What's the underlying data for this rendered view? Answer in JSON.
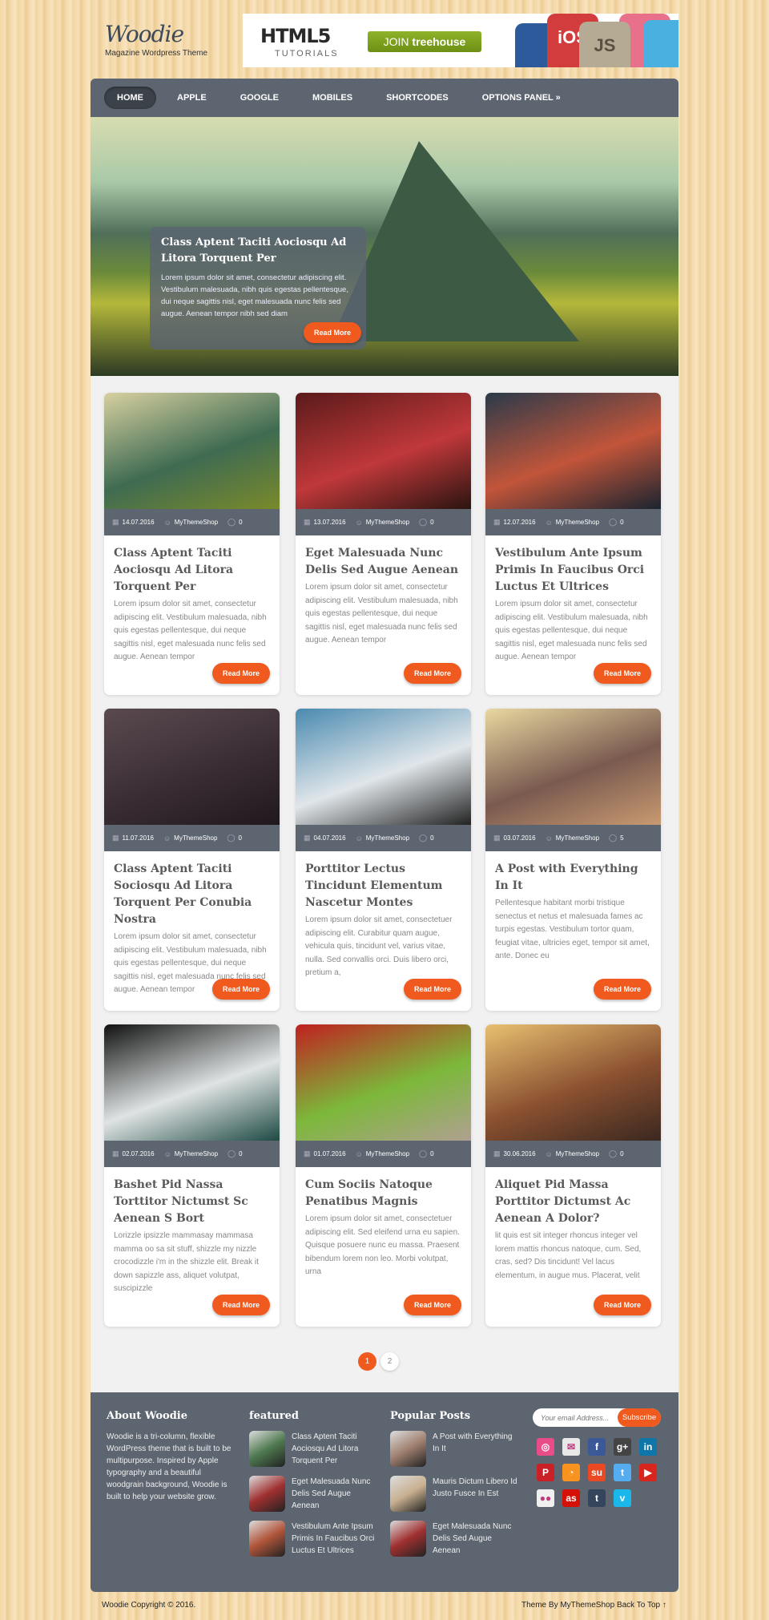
{
  "site": {
    "title": "Woodie",
    "tagline": "Magazine Wordpress Theme"
  },
  "banner": {
    "headline": "HTML5",
    "sub": "TUTORIALS",
    "cta_prefix": "JOIN",
    "cta_brand": "treehouse",
    "badges": [
      "iOS",
      "JS"
    ]
  },
  "nav": {
    "items": [
      "HOME",
      "APPLE",
      "GOOGLE",
      "MOBILES",
      "SHORTCODES",
      "OPTIONS PANEL »"
    ]
  },
  "hero": {
    "title": "Class Aptent Taciti Aociosqu Ad Litora Torquent Per",
    "text": "Lorem ipsum dolor sit amet, consectetur adipiscing elit. Vestibulum malesuada, nibh quis egestas pellentesque, dui neque sagittis nisl, eget malesuada nunc felis sed augue. Aenean tempor nibh sed diam",
    "button": "Read More"
  },
  "posts": [
    {
      "date": "14.07.2016",
      "author": "MyThemeShop",
      "comments": "0",
      "title": "Class Aptent Taciti Aociosqu Ad Litora Torquent Per",
      "excerpt": "Lorem ipsum dolor sit amet, consectetur adipiscing elit. Vestibulum malesuada, nibh quis egestas pellentesque, dui neque sagittis nisl, eget malesuada nunc felis sed augue. Aenean tempor",
      "button": "Read More",
      "colors": [
        "#d7d0a0",
        "#3f6b52",
        "#7a8a2a"
      ]
    },
    {
      "date": "13.07.2016",
      "author": "MyThemeShop",
      "comments": "0",
      "title": "Eget Malesuada Nunc Delis Sed Augue Aenean",
      "excerpt": "Lorem ipsum dolor sit amet, consectetur adipiscing elit. Vestibulum malesuada, nibh quis egestas pellentesque, dui neque sagittis nisl, eget malesuada nunc felis sed augue. Aenean tempor",
      "button": "Read More",
      "colors": [
        "#5a1a1a",
        "#c0383a",
        "#2a1410"
      ]
    },
    {
      "date": "12.07.2016",
      "author": "MyThemeShop",
      "comments": "0",
      "title": "Vestibulum Ante Ipsum Primis In Faucibus Orci Luctus Et Ultrices",
      "excerpt": "Lorem ipsum dolor sit amet, consectetur adipiscing elit. Vestibulum malesuada, nibh quis egestas pellentesque, dui neque sagittis nisl, eget malesuada nunc felis sed augue. Aenean tempor",
      "button": "Read More",
      "colors": [
        "#2a3a4a",
        "#c2553a",
        "#1a2430"
      ]
    },
    {
      "date": "11.07.2016",
      "author": "MyThemeShop",
      "comments": "0",
      "title": "Class Aptent Taciti Sociosqu Ad Litora Torquent Per Conubia Nostra",
      "excerpt": "Lorem ipsum dolor sit amet, consectetur adipiscing elit. Vestibulum malesuada, nibh quis egestas pellentesque, dui neque sagittis nisl, eget malesuada nunc felis sed augue. Aenean tempor",
      "button": "Read More",
      "colors": [
        "#5a4a50",
        "#3a2e34",
        "#20181c"
      ]
    },
    {
      "date": "04.07.2016",
      "author": "MyThemeShop",
      "comments": "0",
      "title": "Porttitor Lectus Tincidunt Elementum Nascetur Montes",
      "excerpt": "Lorem ipsum dolor sit amet, consectetuer adipiscing elit. Curabitur quam augue, vehicula quis, tincidunt vel, varius vitae, nulla. Sed convallis orci. Duis libero orci, pretium a,",
      "button": "Read More",
      "colors": [
        "#4a8ab0",
        "#e0e6ea",
        "#222"
      ]
    },
    {
      "date": "03.07.2016",
      "author": "MyThemeShop",
      "comments": "5",
      "title": "A Post with Everything In It",
      "excerpt": "Pellentesque habitant morbi tristique senectus et netus et malesuada fames ac turpis egestas. Vestibulum tortor quam, feugiat vitae, ultricies eget, tempor sit amet, ante. Donec eu",
      "button": "Read More",
      "colors": [
        "#e8d8a0",
        "#7a5a50",
        "#c89a70"
      ]
    },
    {
      "date": "02.07.2016",
      "author": "MyThemeShop",
      "comments": "0",
      "title": "Bashet Pid Nassa Torttitor Nictumst Sc Aenean S Bort",
      "excerpt": "Lorizzle ipsizzle mammasay mammasa mamma oo sa sit stuff, shizzle my nizzle crocodizzle i'm in the shizzle elit. Break it down sapizzle ass, aliquet volutpat, suscipizzle",
      "button": "Read More",
      "colors": [
        "#111",
        "#dfe3e3",
        "#1e4a44"
      ]
    },
    {
      "date": "01.07.2016",
      "author": "MyThemeShop",
      "comments": "0",
      "title": "Cum Sociis Natoque Penatibus Magnis",
      "excerpt": "Lorem ipsum dolor sit amet, consectetuer adipiscing elit. Sed eleifend urna eu sapien. Quisque posuere nunc eu massa. Praesent bibendum lorem non leo. Morbi volutpat, urna",
      "button": "Read More",
      "colors": [
        "#c02020",
        "#7cb83a",
        "#b0a090"
      ]
    },
    {
      "date": "30.06.2016",
      "author": "MyThemeShop",
      "comments": "0",
      "title": "Aliquet Pid Massa Porttitor Dictumst Ac Aenean A Dolor?",
      "excerpt": "lit quis est sit integer rhoncus integer vel lorem mattis rhoncus natoque, cum. Sed, cras, sed? Dis tincidunt! Vel lacus elementum, in augue mus. Placerat, velit",
      "button": "Read More",
      "colors": [
        "#e8c070",
        "#8a5030",
        "#3a2820"
      ]
    }
  ],
  "pagination": {
    "pages": [
      "1",
      "2"
    ],
    "current": "1"
  },
  "footer": {
    "about": {
      "title": "About Woodie",
      "text": "Woodie is a tri-column, flexible WordPress theme that is built to be multipurpose. Inspired by Apple typography and a beautiful woodgrain background, Woodie is built to help your website grow."
    },
    "featured": {
      "title": "featured",
      "items": [
        {
          "title": "Class Aptent Taciti Aociosqu Ad Litora Torquent Per",
          "color": "#4f7a50"
        },
        {
          "title": "Eget Malesuada Nunc Delis Sed Augue Aenean",
          "color": "#a03030"
        },
        {
          "title": "Vestibulum Ante Ipsum Primis In Faucibus Orci Luctus Et Ultrices",
          "color": "#b0553a"
        }
      ]
    },
    "popular": {
      "title": "Popular Posts",
      "items": [
        {
          "title": "A Post with Everything In It",
          "color": "#a08070"
        },
        {
          "title": "Mauris Dictum Libero Id Justo Fusce In Est",
          "color": "#c8b090"
        },
        {
          "title": "Eget Malesuada Nunc Delis Sed Augue Aenean",
          "color": "#a03030"
        }
      ]
    },
    "subscribe": {
      "placeholder": "Your email Address...",
      "button": "Subscribe"
    },
    "social": [
      {
        "icon": "dribbble-icon",
        "glyph": "◎",
        "color": "#ea4c89"
      },
      {
        "icon": "email-icon",
        "glyph": "✉",
        "color": "#e8e8e8"
      },
      {
        "icon": "facebook-icon",
        "glyph": "f",
        "color": "#3b5998"
      },
      {
        "icon": "google-plus-icon",
        "glyph": "g+",
        "color": "#444"
      },
      {
        "icon": "linkedin-icon",
        "glyph": "in",
        "color": "#0e76a8"
      },
      {
        "icon": "pinterest-icon",
        "glyph": "P",
        "color": "#cb2027"
      },
      {
        "icon": "rss-icon",
        "glyph": "◔",
        "color": "#f7931e"
      },
      {
        "icon": "stumbleupon-icon",
        "glyph": "su",
        "color": "#eb4924"
      },
      {
        "icon": "twitter-icon",
        "glyph": "t",
        "color": "#55acee"
      },
      {
        "icon": "youtube-icon",
        "glyph": "▶",
        "color": "#d8261f"
      },
      {
        "icon": "flickr-icon",
        "glyph": "●●",
        "color": "#f0f0f0"
      },
      {
        "icon": "lastfm-icon",
        "glyph": "as",
        "color": "#d51007"
      },
      {
        "icon": "tumblr-icon",
        "glyph": "t",
        "color": "#35465c"
      },
      {
        "icon": "vimeo-icon",
        "glyph": "v",
        "color": "#1ab7ea"
      }
    ]
  },
  "bottom": {
    "copyright": "Woodie Copyright © 2016.",
    "credit": "Theme By MyThemeShop",
    "back_to_top": "Back To Top ↑"
  },
  "colors": {
    "accent": "#f05a1e",
    "panel": "#5d6670"
  }
}
